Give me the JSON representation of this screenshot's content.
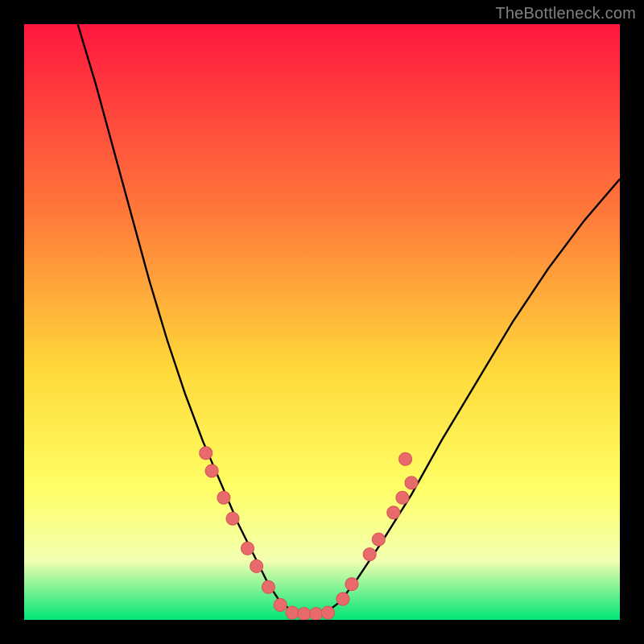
{
  "watermark": "TheBottleneck.com",
  "colors": {
    "gradient_top": "#ff173e",
    "gradient_mid_upper": "#ff7a3a",
    "gradient_mid": "#ffd93a",
    "gradient_mid_lower": "#ffff66",
    "gradient_lower": "#f3ffb0",
    "gradient_bottom": "#00e576",
    "curve": "#000000",
    "dot": "#e86a6a",
    "dot_stroke": "#d45555"
  },
  "chart_data": {
    "type": "line",
    "title": "",
    "xlabel": "",
    "ylabel": "",
    "xlim": [
      0,
      100
    ],
    "ylim": [
      0,
      100
    ],
    "series": [
      {
        "name": "bottleneck-curve",
        "x": [
          9,
          12,
          15,
          18,
          21,
          24,
          27,
          30,
          33,
          36,
          39,
          41,
          43,
          45,
          47,
          49,
          51,
          53,
          56,
          60,
          65,
          70,
          76,
          82,
          88,
          94,
          100
        ],
        "values": [
          100,
          90,
          79,
          68,
          57,
          47,
          38,
          30,
          23,
          16,
          10,
          6,
          3,
          1.5,
          1,
          1,
          1.5,
          3,
          7,
          13,
          21,
          30,
          40,
          50,
          59,
          67,
          74
        ]
      }
    ],
    "dots_left": [
      {
        "x": 30.5,
        "y": 28
      },
      {
        "x": 31.5,
        "y": 25
      },
      {
        "x": 33.5,
        "y": 20.5
      },
      {
        "x": 35,
        "y": 17
      },
      {
        "x": 37.5,
        "y": 12
      },
      {
        "x": 39,
        "y": 9
      },
      {
        "x": 41,
        "y": 5.5
      },
      {
        "x": 43,
        "y": 2.5
      }
    ],
    "dots_bottom": [
      {
        "x": 45,
        "y": 1.2
      },
      {
        "x": 47,
        "y": 1
      },
      {
        "x": 49,
        "y": 1
      },
      {
        "x": 51,
        "y": 1.2
      }
    ],
    "dots_right": [
      {
        "x": 53.5,
        "y": 3.5
      },
      {
        "x": 55,
        "y": 6
      },
      {
        "x": 58,
        "y": 11
      },
      {
        "x": 59.5,
        "y": 13.5
      },
      {
        "x": 62,
        "y": 18
      },
      {
        "x": 63.5,
        "y": 20.5
      },
      {
        "x": 65,
        "y": 23
      },
      {
        "x": 64,
        "y": 27
      }
    ]
  }
}
